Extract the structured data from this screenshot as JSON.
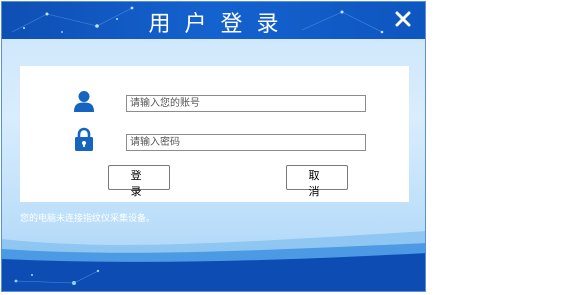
{
  "window": {
    "title": "用户登录",
    "close_glyph": "✕"
  },
  "form": {
    "username": {
      "value": "",
      "placeholder": "请输入您的账号",
      "icon": "user-icon"
    },
    "password": {
      "value": "",
      "placeholder": "请输入密码",
      "icon": "lock-icon"
    }
  },
  "buttons": {
    "login_label": "登 录",
    "cancel_label": "取 消"
  },
  "status_text": "您的电脑未连接指纹仪采集设备。",
  "colors": {
    "title_bar": "#1462cf",
    "icon_blue": "#1565c0",
    "panel": "#ffffff",
    "wave_dark": "#0d4db3"
  }
}
